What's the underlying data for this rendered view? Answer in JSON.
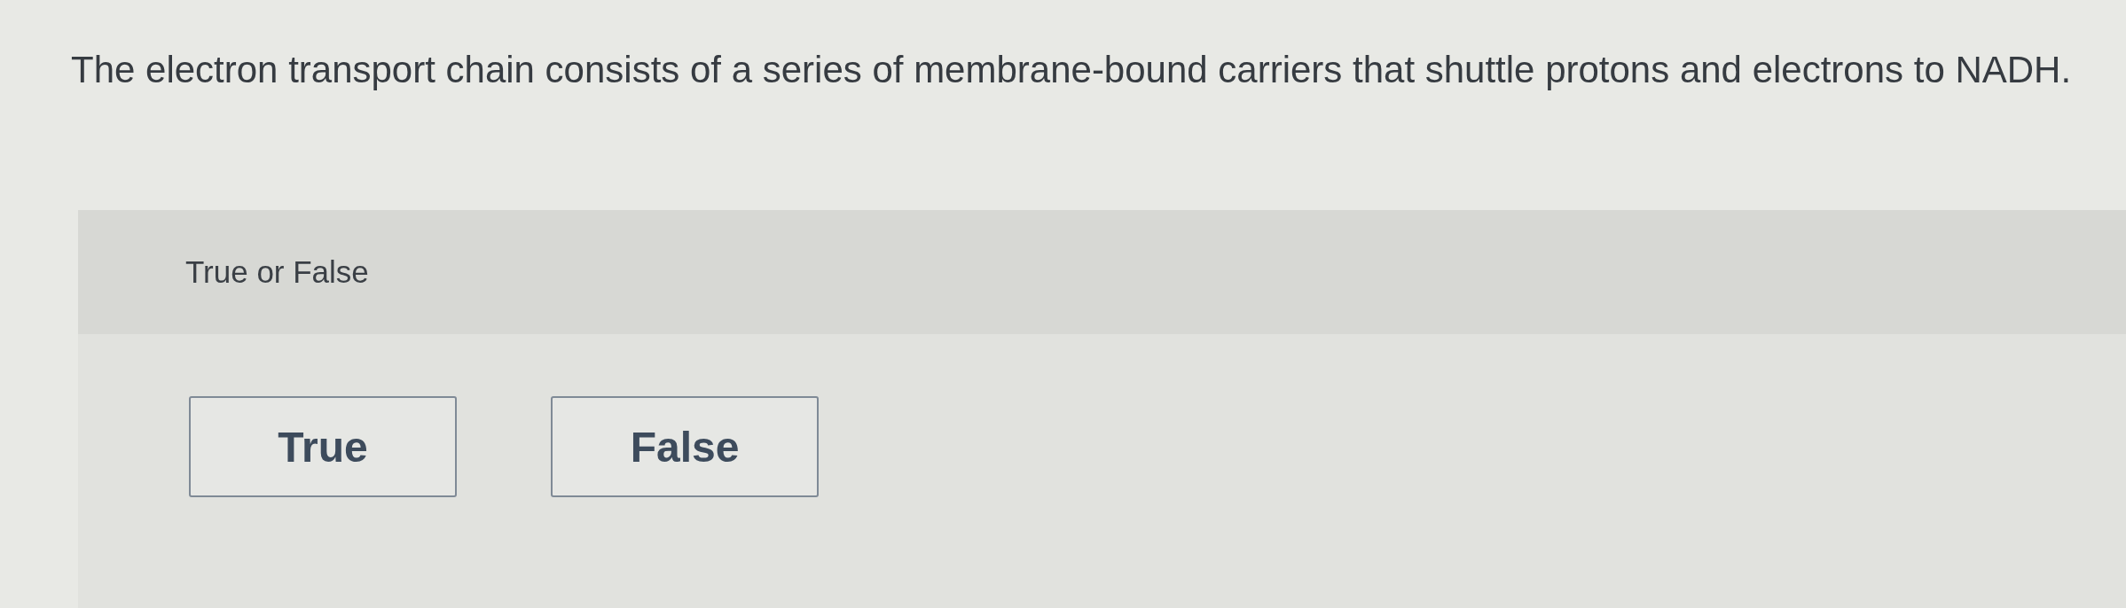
{
  "question": {
    "text": "The electron transport chain consists of a series of membrane-bound carriers that shuttle protons and electrons to NADH."
  },
  "prompt_bar": {
    "label": "True or False"
  },
  "choices": [
    {
      "label": "True",
      "selected": false
    },
    {
      "label": "False",
      "selected": false
    }
  ]
}
